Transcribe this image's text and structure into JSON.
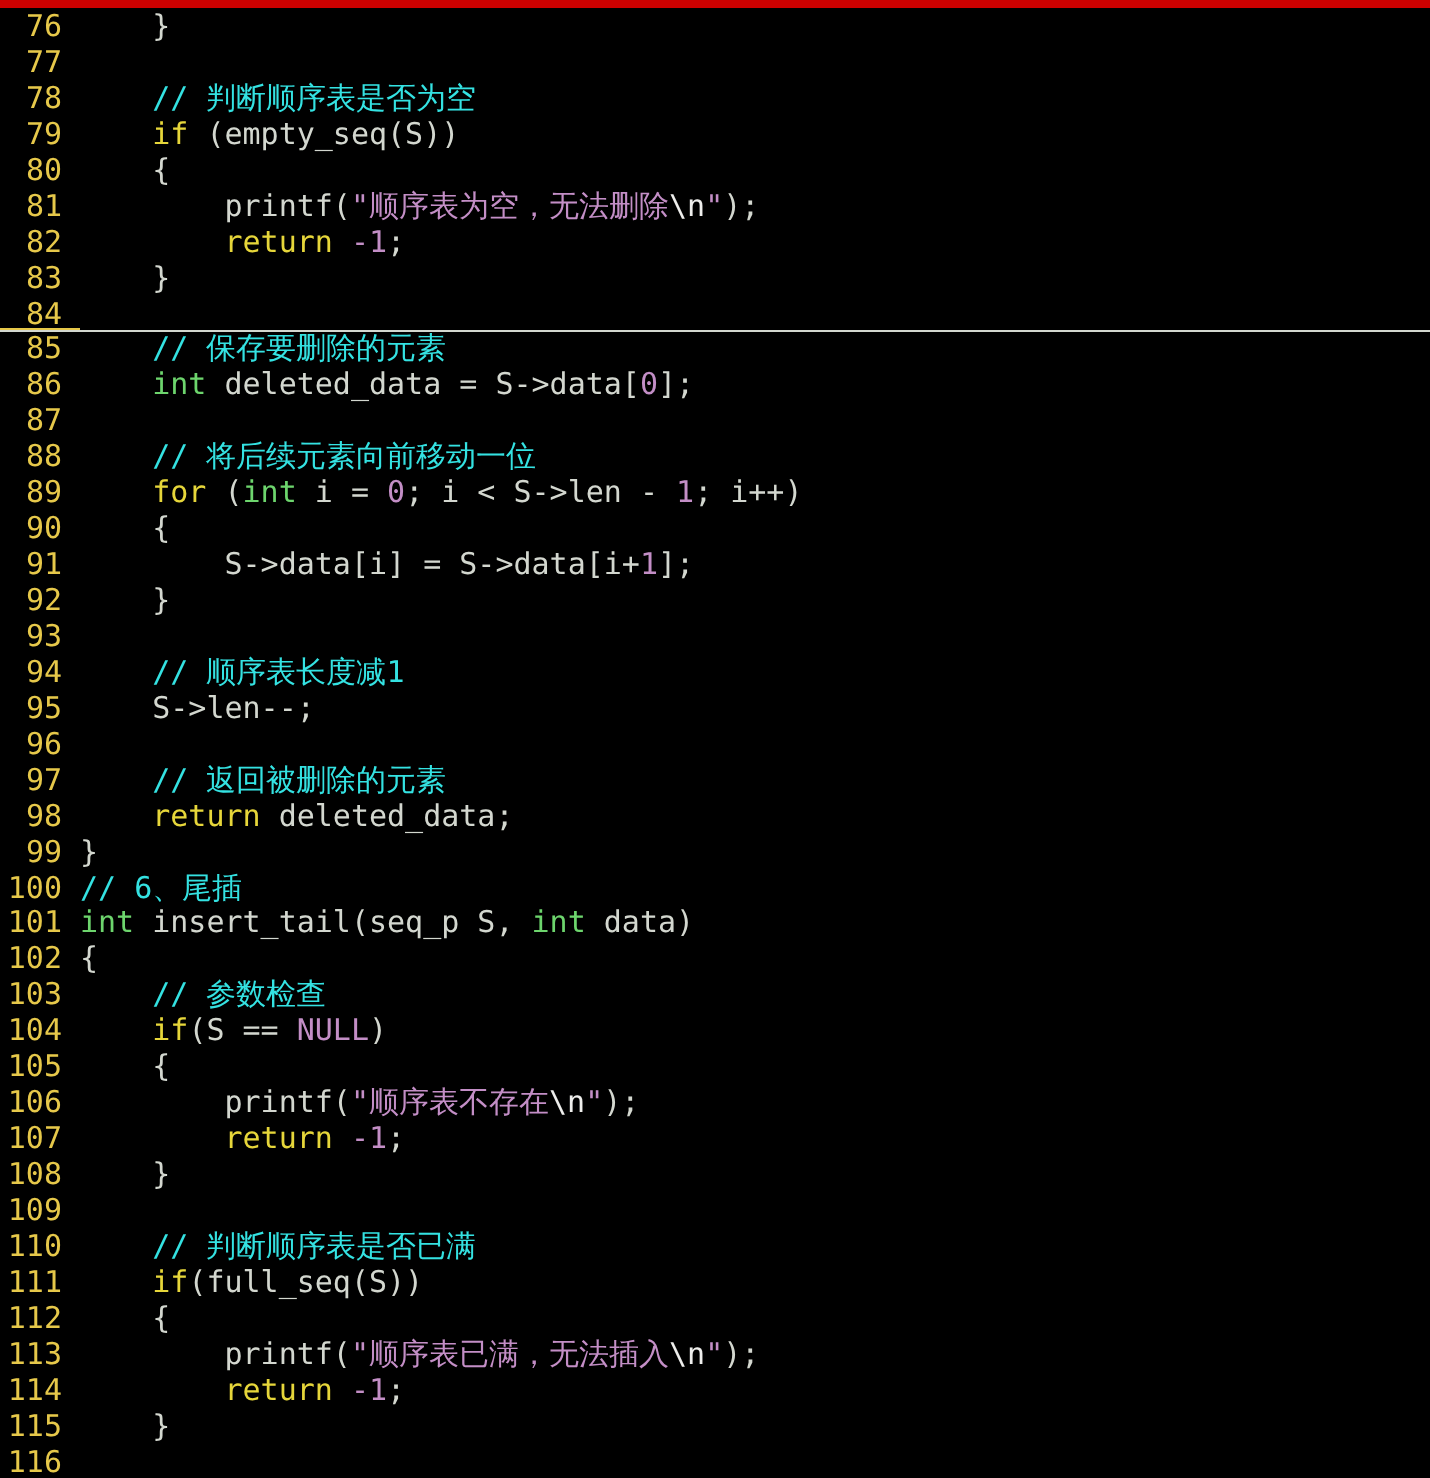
{
  "editor": {
    "lines": [
      {
        "number": "76",
        "current": false,
        "tokens": [
          {
            "kind": "plain",
            "text": "    }"
          }
        ]
      },
      {
        "number": "77",
        "current": false
      },
      {
        "number": "78",
        "current": false,
        "tokens": [
          {
            "kind": "comment",
            "text": "    // 判断顺序表是否为空"
          }
        ]
      },
      {
        "number": "79",
        "current": false,
        "tokens": [
          {
            "kind": "statement",
            "text": "    if"
          },
          {
            "kind": "plain",
            "text": " (empty_seq(S))"
          }
        ]
      },
      {
        "number": "80",
        "current": false,
        "tokens": [
          {
            "kind": "plain",
            "text": "    {"
          }
        ]
      },
      {
        "number": "81",
        "current": false,
        "tokens": [
          {
            "kind": "plain",
            "text": "        printf("
          },
          {
            "kind": "string",
            "text": "\"顺序表为空，无法删除"
          },
          {
            "kind": "special",
            "text": "\\n"
          },
          {
            "kind": "string",
            "text": "\""
          },
          {
            "kind": "plain",
            "text": ");"
          }
        ]
      },
      {
        "number": "82",
        "current": false,
        "tokens": [
          {
            "kind": "statement",
            "text": "        return"
          },
          {
            "kind": "constant",
            "text": " -1"
          },
          {
            "kind": "plain",
            "text": ";"
          }
        ]
      },
      {
        "number": "83",
        "current": false,
        "tokens": [
          {
            "kind": "plain",
            "text": "    }"
          }
        ]
      },
      {
        "number": "84",
        "current": true
      },
      {
        "number": "85",
        "current": false,
        "tokens": [
          {
            "kind": "comment",
            "text": "    // 保存要删除的元素"
          }
        ]
      },
      {
        "number": "86",
        "current": false,
        "tokens": [
          {
            "kind": "type",
            "text": "    int"
          },
          {
            "kind": "plain",
            "text": " deleted_data = S->data["
          },
          {
            "kind": "constant",
            "text": "0"
          },
          {
            "kind": "plain",
            "text": "];"
          }
        ]
      },
      {
        "number": "87",
        "current": false
      },
      {
        "number": "88",
        "current": false,
        "tokens": [
          {
            "kind": "comment",
            "text": "    // 将后续元素向前移动一位"
          }
        ]
      },
      {
        "number": "89",
        "current": false,
        "tokens": [
          {
            "kind": "statement",
            "text": "    for"
          },
          {
            "kind": "plain",
            "text": " ("
          },
          {
            "kind": "type",
            "text": "int"
          },
          {
            "kind": "plain",
            "text": " i = "
          },
          {
            "kind": "constant",
            "text": "0"
          },
          {
            "kind": "plain",
            "text": "; i < S->len - "
          },
          {
            "kind": "constant",
            "text": "1"
          },
          {
            "kind": "plain",
            "text": "; i++)"
          }
        ]
      },
      {
        "number": "90",
        "current": false,
        "tokens": [
          {
            "kind": "plain",
            "text": "    {"
          }
        ]
      },
      {
        "number": "91",
        "current": false,
        "tokens": [
          {
            "kind": "plain",
            "text": "        S->data[i] = S->data[i+"
          },
          {
            "kind": "constant",
            "text": "1"
          },
          {
            "kind": "plain",
            "text": "];"
          }
        ]
      },
      {
        "number": "92",
        "current": false,
        "tokens": [
          {
            "kind": "plain",
            "text": "    }"
          }
        ]
      },
      {
        "number": "93",
        "current": false
      },
      {
        "number": "94",
        "current": false,
        "tokens": [
          {
            "kind": "comment",
            "text": "    // 顺序表长度减1"
          }
        ]
      },
      {
        "number": "95",
        "current": false,
        "tokens": [
          {
            "kind": "plain",
            "text": "    S->len--;"
          }
        ]
      },
      {
        "number": "96",
        "current": false
      },
      {
        "number": "97",
        "current": false,
        "tokens": [
          {
            "kind": "comment",
            "text": "    // 返回被删除的元素"
          }
        ]
      },
      {
        "number": "98",
        "current": false,
        "tokens": [
          {
            "kind": "statement",
            "text": "    return"
          },
          {
            "kind": "plain",
            "text": " deleted_data;"
          }
        ]
      },
      {
        "number": "99",
        "current": false,
        "tokens": [
          {
            "kind": "plain",
            "text": "}"
          }
        ]
      },
      {
        "number": "100",
        "current": false,
        "tokens": [
          {
            "kind": "comment",
            "text": "// 6、尾插"
          }
        ]
      },
      {
        "number": "101",
        "current": false,
        "tokens": [
          {
            "kind": "type",
            "text": "int"
          },
          {
            "kind": "plain",
            "text": " insert_tail(seq_p S, "
          },
          {
            "kind": "type",
            "text": "int"
          },
          {
            "kind": "plain",
            "text": " data)"
          }
        ]
      },
      {
        "number": "102",
        "current": false,
        "tokens": [
          {
            "kind": "plain",
            "text": "{"
          }
        ]
      },
      {
        "number": "103",
        "current": false,
        "tokens": [
          {
            "kind": "comment",
            "text": "    // 参数检查"
          }
        ]
      },
      {
        "number": "104",
        "current": false,
        "tokens": [
          {
            "kind": "statement",
            "text": "    if"
          },
          {
            "kind": "plain",
            "text": "(S == "
          },
          {
            "kind": "constant",
            "text": "NULL"
          },
          {
            "kind": "plain",
            "text": ")"
          }
        ]
      },
      {
        "number": "105",
        "current": false,
        "tokens": [
          {
            "kind": "plain",
            "text": "    {"
          }
        ]
      },
      {
        "number": "106",
        "current": false,
        "tokens": [
          {
            "kind": "plain",
            "text": "        printf("
          },
          {
            "kind": "string",
            "text": "\"顺序表不存在"
          },
          {
            "kind": "special",
            "text": "\\n"
          },
          {
            "kind": "string",
            "text": "\""
          },
          {
            "kind": "plain",
            "text": ");"
          }
        ]
      },
      {
        "number": "107",
        "current": false,
        "tokens": [
          {
            "kind": "statement",
            "text": "        return"
          },
          {
            "kind": "constant",
            "text": " -1"
          },
          {
            "kind": "plain",
            "text": ";"
          }
        ]
      },
      {
        "number": "108",
        "current": false,
        "tokens": [
          {
            "kind": "plain",
            "text": "    }"
          }
        ]
      },
      {
        "number": "109",
        "current": false
      },
      {
        "number": "110",
        "current": false,
        "tokens": [
          {
            "kind": "comment",
            "text": "    // 判断顺序表是否已满"
          }
        ]
      },
      {
        "number": "111",
        "current": false,
        "tokens": [
          {
            "kind": "statement",
            "text": "    if"
          },
          {
            "kind": "plain",
            "text": "(full_seq(S))"
          }
        ]
      },
      {
        "number": "112",
        "current": false,
        "tokens": [
          {
            "kind": "plain",
            "text": "    {"
          }
        ]
      },
      {
        "number": "113",
        "current": false,
        "tokens": [
          {
            "kind": "plain",
            "text": "        printf("
          },
          {
            "kind": "string",
            "text": "\"顺序表已满，无法插入"
          },
          {
            "kind": "special",
            "text": "\\n"
          },
          {
            "kind": "string",
            "text": "\""
          },
          {
            "kind": "plain",
            "text": ");"
          }
        ]
      },
      {
        "number": "114",
        "current": false,
        "tokens": [
          {
            "kind": "statement",
            "text": "        return"
          },
          {
            "kind": "constant",
            "text": " -1"
          },
          {
            "kind": "plain",
            "text": ";"
          }
        ]
      },
      {
        "number": "115",
        "current": false,
        "tokens": [
          {
            "kind": "plain",
            "text": "    }"
          }
        ]
      },
      {
        "number": "116",
        "current": false
      }
    ]
  }
}
